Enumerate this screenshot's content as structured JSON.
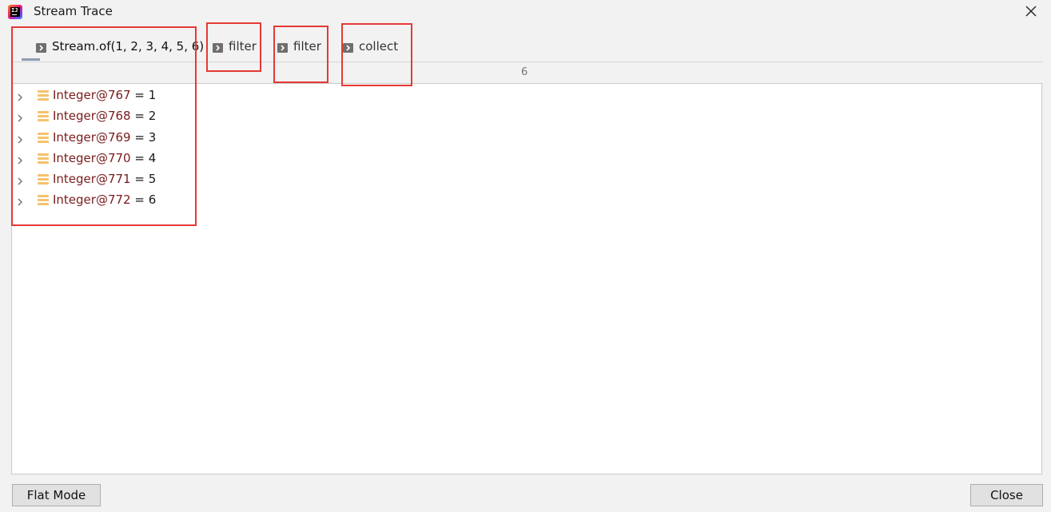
{
  "window": {
    "title": "Stream Trace",
    "app_icon": "intellij-idea-icon",
    "close_icon": "close-icon"
  },
  "tabs": [
    {
      "label": "Stream.of(1, 2, 3, 4, 5, 6)",
      "icon": "stream-step-icon",
      "active": true
    },
    {
      "label": "filter",
      "icon": "stream-step-icon",
      "active": false
    },
    {
      "label": "filter",
      "icon": "stream-step-icon",
      "active": false
    },
    {
      "label": "collect",
      "icon": "stream-step-icon",
      "active": false
    }
  ],
  "item_count": "6",
  "items": [
    {
      "name": "Integer@767",
      "rest": " = 1"
    },
    {
      "name": "Integer@768",
      "rest": " = 2"
    },
    {
      "name": "Integer@769",
      "rest": " = 3"
    },
    {
      "name": "Integer@770",
      "rest": " = 4"
    },
    {
      "name": "Integer@771",
      "rest": " = 5"
    },
    {
      "name": "Integer@772",
      "rest": " = 6"
    }
  ],
  "buttons": {
    "flat_mode": "Flat Mode",
    "close": "Close"
  },
  "colors": {
    "annotation": "#e53935",
    "value_name": "#7a1b1b",
    "field_icon": "#f5c26b",
    "active_tab_underline": "#8f9bb3"
  }
}
